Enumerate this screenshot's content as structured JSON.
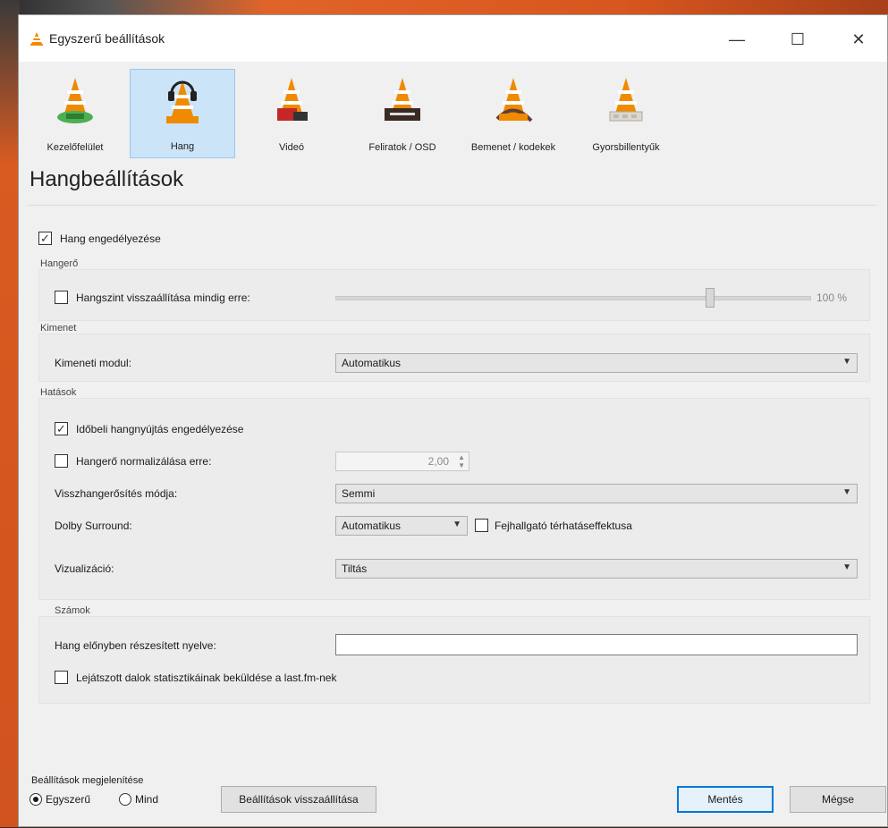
{
  "window": {
    "title": "Egyszerű beállítások",
    "controls": {
      "minimize": "—",
      "maximize": "☐",
      "close": "✕"
    }
  },
  "toolbar": {
    "categories": [
      {
        "label": "Kezelőfelület",
        "icon": "interface-icon"
      },
      {
        "label": "Hang",
        "icon": "audio-icon"
      },
      {
        "label": "Videó",
        "icon": "video-icon"
      },
      {
        "label": "Feliratok / OSD",
        "icon": "subtitles-icon"
      },
      {
        "label": "Bemenet / kodekek",
        "icon": "input-codecs-icon"
      },
      {
        "label": "Gyorsbillentyűk",
        "icon": "hotkeys-icon"
      }
    ],
    "active": "Hang"
  },
  "page": {
    "title": "Hangbeállítások",
    "enable_audio": {
      "label": "Hang engedélyezése",
      "checked": true
    },
    "volume": {
      "group": "Hangerő",
      "reset_label": "Hangszint visszaállítása mindig erre:",
      "reset_checked": false,
      "slider_level_percent": 100,
      "value": "100 %"
    },
    "output": {
      "group": "Kimenet",
      "module_label": "Kimeneti modul:",
      "module_value": "Automatikus"
    },
    "effects": {
      "group": "Hatások",
      "timestretch_label": "Időbeli hangnyújtás engedélyezése",
      "timestretch_checked": true,
      "normalize_label": "Hangerő normalizálása erre:",
      "normalize_checked": false,
      "normalize_value": "2,00",
      "replay_gain_label": "Visszhangerősítés módja:",
      "replay_gain_value": "Semmi",
      "dolby_label": "Dolby Surround:",
      "dolby_value": "Automatikus",
      "headphone_label": "Fejhallgató térhatáseffektusa",
      "headphone_checked": false,
      "visualization_label": "Vizualizáció:",
      "visualization_value": "Tiltás"
    },
    "tracks": {
      "group": "Számok",
      "preferred_lang_label": "Hang előnyben részesített nyelve:",
      "preferred_lang_value": "",
      "lastfm_label": "Lejátszott dalok statisztikáinak beküldése a last.fm-nek",
      "lastfm_checked": false
    }
  },
  "footer": {
    "show_settings_label": "Beállítások megjelenítése",
    "simple_label": "Egyszerű",
    "all_label": "Mind",
    "selected": "Egyszerű",
    "reset_button": "Beállítások visszaállítása",
    "save_button": "Mentés",
    "cancel_button": "Mégse"
  },
  "colors": {
    "accent": "#0078d7",
    "active_tab_bg": "#cce4f7",
    "vlc_orange": "#f08a00"
  }
}
